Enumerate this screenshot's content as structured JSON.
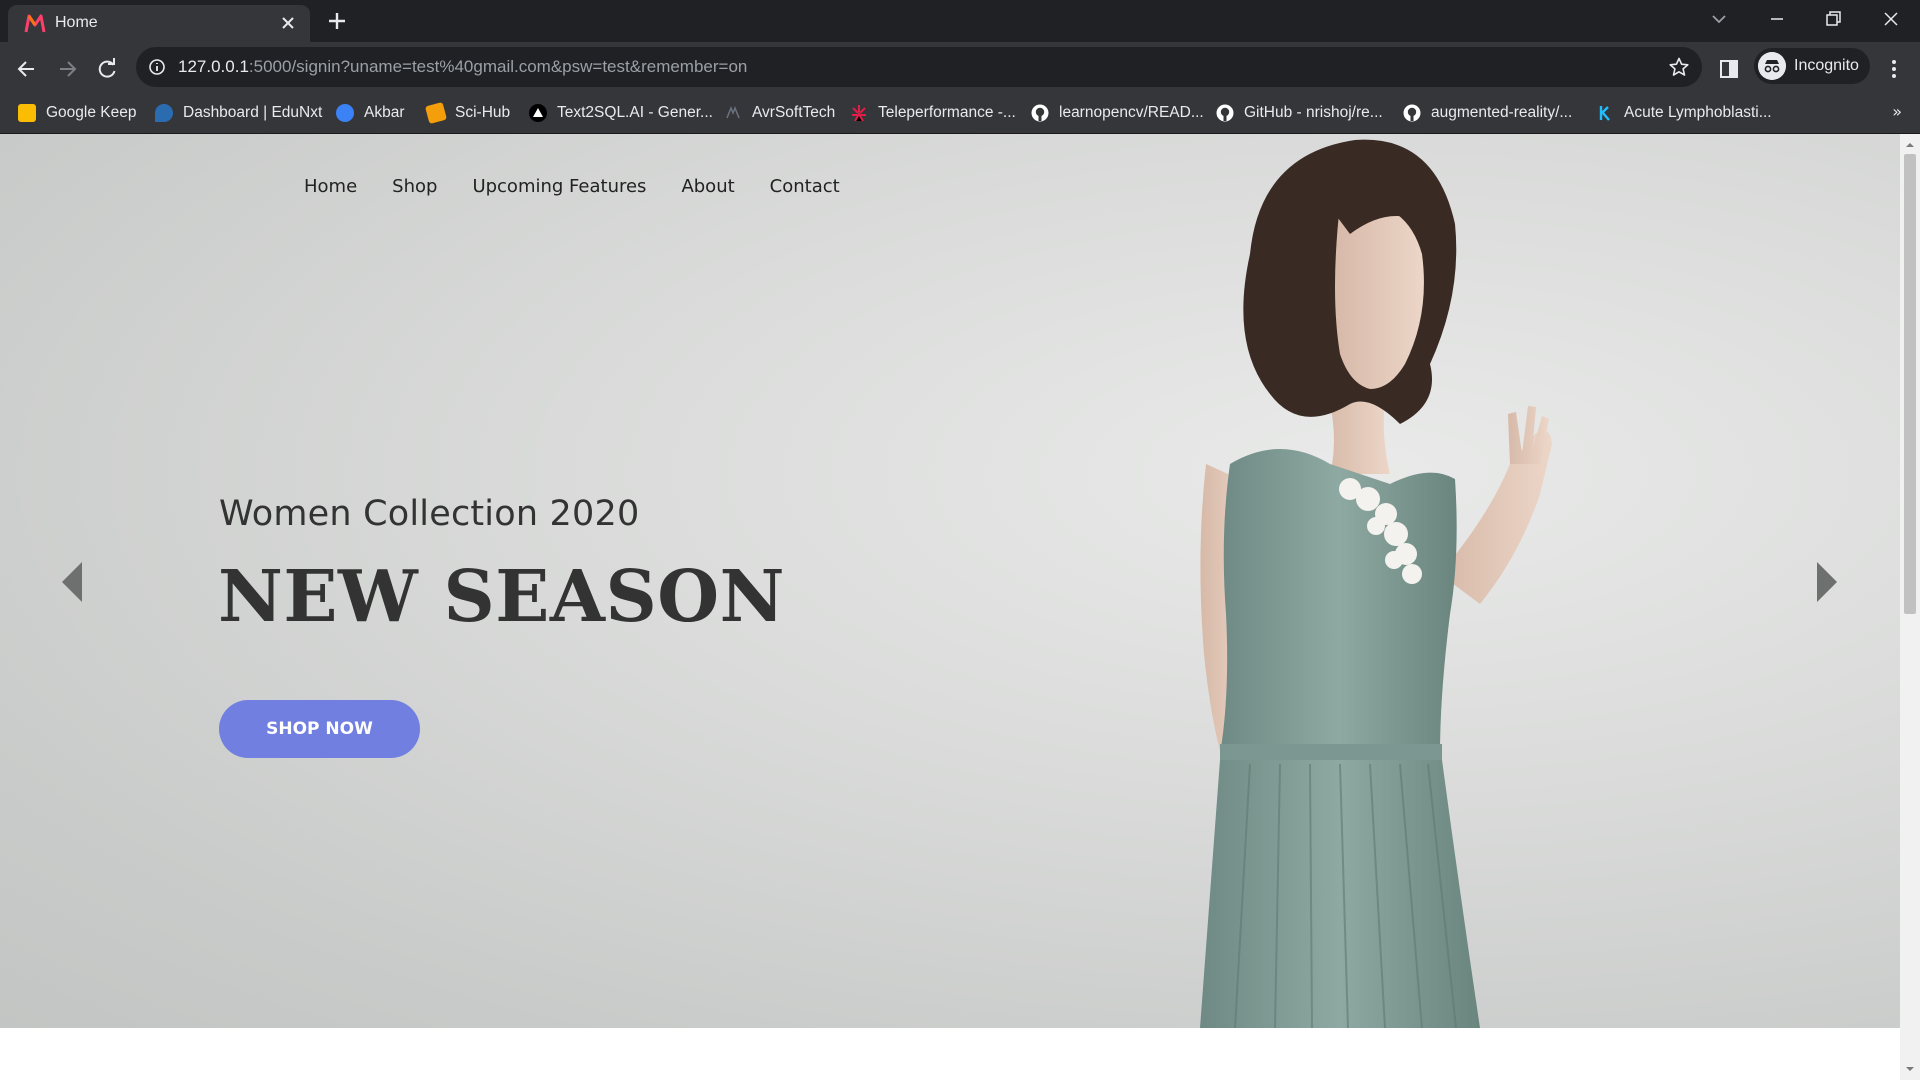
{
  "browser": {
    "tab_title": "Home",
    "url_host": "127.0.0.1",
    "url_rest": ":5000/signin?uname=test%40gmail.com&psw=test&remember=on",
    "incognito_label": "Incognito",
    "bookmarks": [
      {
        "label": "Google Keep",
        "icon": "keep-icon",
        "color": "#fbbc04"
      },
      {
        "label": "Dashboard | EduNxt",
        "icon": "edunxt-icon",
        "color": "#2b6cb0"
      },
      {
        "label": "Akbar",
        "icon": "akbar-icon",
        "color": "#3b82f6"
      },
      {
        "label": "Sci-Hub",
        "icon": "scihub-icon",
        "color": "#f59e0b"
      },
      {
        "label": "Text2SQL.AI - Gener...",
        "icon": "text2sql-icon",
        "color": "#ffffff"
      },
      {
        "label": "AvrSoftTech",
        "icon": "avrsofttech-icon",
        "color": "#4b5563"
      },
      {
        "label": "Teleperformance -...",
        "icon": "teleperformance-icon",
        "color": "#e11d48"
      },
      {
        "label": "learnopencv/READ...",
        "icon": "github-icon",
        "color": "#ffffff"
      },
      {
        "label": "GitHub - nrishoj/re...",
        "icon": "github-icon",
        "color": "#ffffff"
      },
      {
        "label": "augmented-reality/...",
        "icon": "github-icon",
        "color": "#ffffff"
      },
      {
        "label": "Acute Lymphoblasti...",
        "icon": "kaggle-icon",
        "color": "#20beff"
      }
    ],
    "more_bookmarks": "»"
  },
  "site": {
    "nav": [
      "Home",
      "Shop",
      "Upcoming Features",
      "About",
      "Contact"
    ],
    "hero_subtitle": "Women Collection 2020",
    "hero_title": "NEW SEASON",
    "cta_label": "SHOP NOW",
    "accent_color": "#717fe0"
  }
}
